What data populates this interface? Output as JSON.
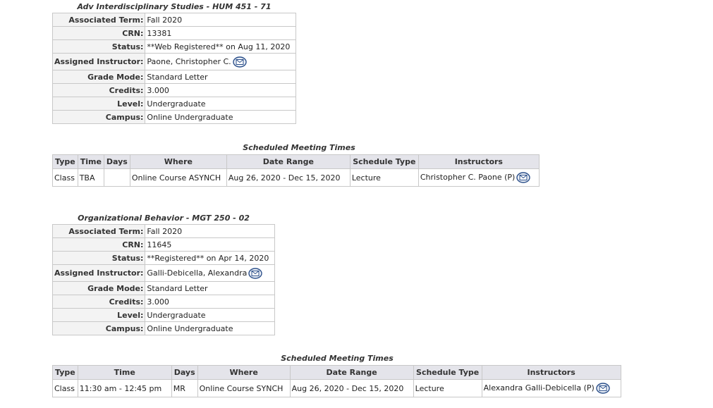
{
  "courses": [
    {
      "title": "Adv Interdisciplinary Studies - HUM 451 - 71",
      "fields": [
        {
          "label": "Associated Term:",
          "value": "Fall 2020"
        },
        {
          "label": "CRN:",
          "value": "13381"
        },
        {
          "label": "Status:",
          "value": "**Web Registered** on Aug 11, 2020"
        },
        {
          "label": "Assigned Instructor:",
          "value": "Paone, Christopher C."
        },
        {
          "label": "Grade Mode:",
          "value": "Standard Letter"
        },
        {
          "label": "Credits:",
          "value": "3.000"
        },
        {
          "label": "Level:",
          "value": "Undergraduate"
        },
        {
          "label": "Campus:",
          "value": "Online Undergraduate"
        }
      ],
      "meeting_caption": "Scheduled Meeting Times",
      "meeting_headers": [
        "Type",
        "Time",
        "Days",
        "Where",
        "Date Range",
        "Schedule Type",
        "Instructors"
      ],
      "meeting_row": [
        "Class",
        "TBA",
        "",
        "Online Course ASYNCH",
        "Aug 26, 2020 - Dec 15, 2020",
        "Lecture",
        "Christopher C. Paone (P)"
      ]
    },
    {
      "title": "Organizational Behavior - MGT 250 - 02",
      "fields": [
        {
          "label": "Associated Term:",
          "value": "Fall 2020"
        },
        {
          "label": "CRN:",
          "value": "11645"
        },
        {
          "label": "Status:",
          "value": "**Registered** on Apr 14, 2020"
        },
        {
          "label": "Assigned Instructor:",
          "value": "Galli-Debicella, Alexandra"
        },
        {
          "label": "Grade Mode:",
          "value": "Standard Letter"
        },
        {
          "label": "Credits:",
          "value": "3.000"
        },
        {
          "label": "Level:",
          "value": "Undergraduate"
        },
        {
          "label": "Campus:",
          "value": "Online Undergraduate"
        }
      ],
      "meeting_caption": "Scheduled Meeting Times",
      "meeting_headers": [
        "Type",
        "Time",
        "Days",
        "Where",
        "Date Range",
        "Schedule Type",
        "Instructors"
      ],
      "meeting_row": [
        "Class",
        "11:30 am - 12:45 pm",
        "MR",
        "Online Course SYNCH",
        "Aug 26, 2020 - Dec 15, 2020",
        "Lecture",
        "Alexandra Galli-Debicella (P)"
      ]
    }
  ],
  "icons": {
    "email": "email-envelope-icon"
  },
  "colors": {
    "header_bg": "#e4e4ea",
    "label_bg": "#f3f3f3",
    "border": "#c8c8c8",
    "icon": "#2b4f8a"
  }
}
